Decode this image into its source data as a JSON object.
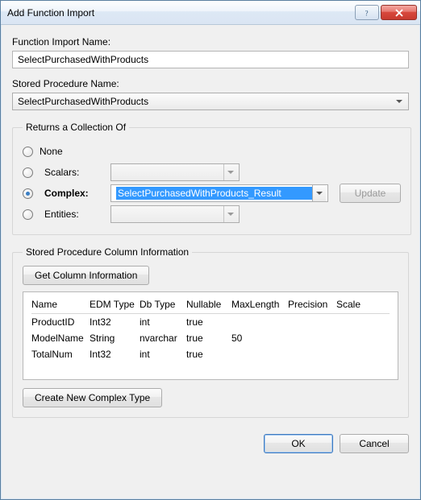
{
  "window": {
    "title": "Add Function Import"
  },
  "labels": {
    "functionImportName": "Function Import Name:",
    "storedProcName": "Stored Procedure Name:"
  },
  "values": {
    "functionImportName": "SelectPurchasedWithProducts",
    "storedProcName": "SelectPurchasedWithProducts"
  },
  "returns": {
    "legend": "Returns a Collection Of",
    "none": "None",
    "scalars": "Scalars:",
    "complex": "Complex:",
    "entities": "Entities:",
    "complexValue": "SelectPurchasedWithProducts_Result",
    "updateLabel": "Update"
  },
  "spInfo": {
    "legend": "Stored Procedure Column Information",
    "getInfoLabel": "Get Column Information",
    "createTypeLabel": "Create New Complex Type",
    "headers": {
      "name": "Name",
      "edm": "EDM Type",
      "db": "Db Type",
      "nullable": "Nullable",
      "maxlen": "MaxLength",
      "precision": "Precision",
      "scale": "Scale"
    },
    "rows": [
      {
        "name": "ProductID",
        "edm": "Int32",
        "db": "int",
        "nullable": "true",
        "maxlen": "",
        "precision": "",
        "scale": ""
      },
      {
        "name": "ModelName",
        "edm": "String",
        "db": "nvarchar",
        "nullable": "true",
        "maxlen": "50",
        "precision": "",
        "scale": ""
      },
      {
        "name": "TotalNum",
        "edm": "Int32",
        "db": "int",
        "nullable": "true",
        "maxlen": "",
        "precision": "",
        "scale": ""
      }
    ]
  },
  "footer": {
    "ok": "OK",
    "cancel": "Cancel"
  }
}
